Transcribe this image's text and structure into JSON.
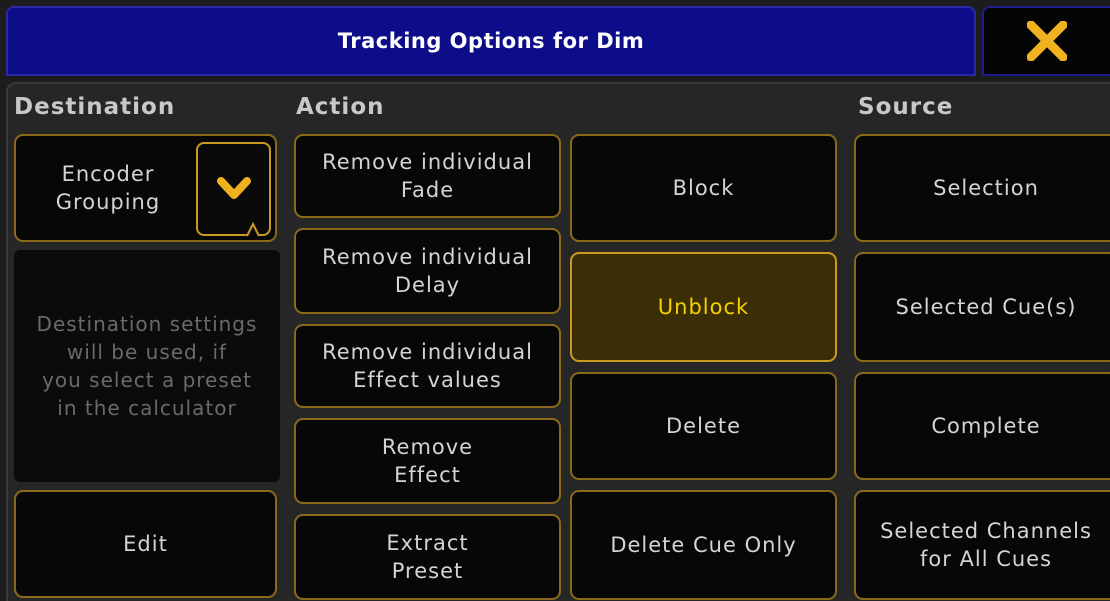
{
  "title": "Tracking Options for Dim",
  "close_icon": "close-x-icon",
  "headers": {
    "destination": "Destination",
    "action": "Action",
    "source": "Source"
  },
  "destination": {
    "dropdown_value": "Encoder\nGrouping",
    "dropdown_icon": "chevron-down-icon",
    "info_text": "Destination settings\nwill be used, if\nyou select a preset\nin the calculator",
    "edit_label": "Edit"
  },
  "action": {
    "remove_fade": "Remove individual\nFade",
    "remove_delay": "Remove individual\nDelay",
    "remove_effect_values": "Remove individual\nEffect values",
    "remove_effect": "Remove\nEffect",
    "extract_preset": "Extract\nPreset",
    "block": "Block",
    "unblock": "Unblock",
    "delete": "Delete",
    "delete_cue_only": "Delete Cue Only"
  },
  "source": {
    "selection": "Selection",
    "selected_cues": "Selected Cue(s)",
    "complete": "Complete",
    "selected_channels_all_cues": "Selected Channels\nfor All Cues"
  },
  "colors": {
    "title_bg": "#0d0d8a",
    "accent_border": "#8a6a1a",
    "active_bg": "#3b2d06",
    "active_text": "#f5d000",
    "close_x": "#f0b21e"
  }
}
